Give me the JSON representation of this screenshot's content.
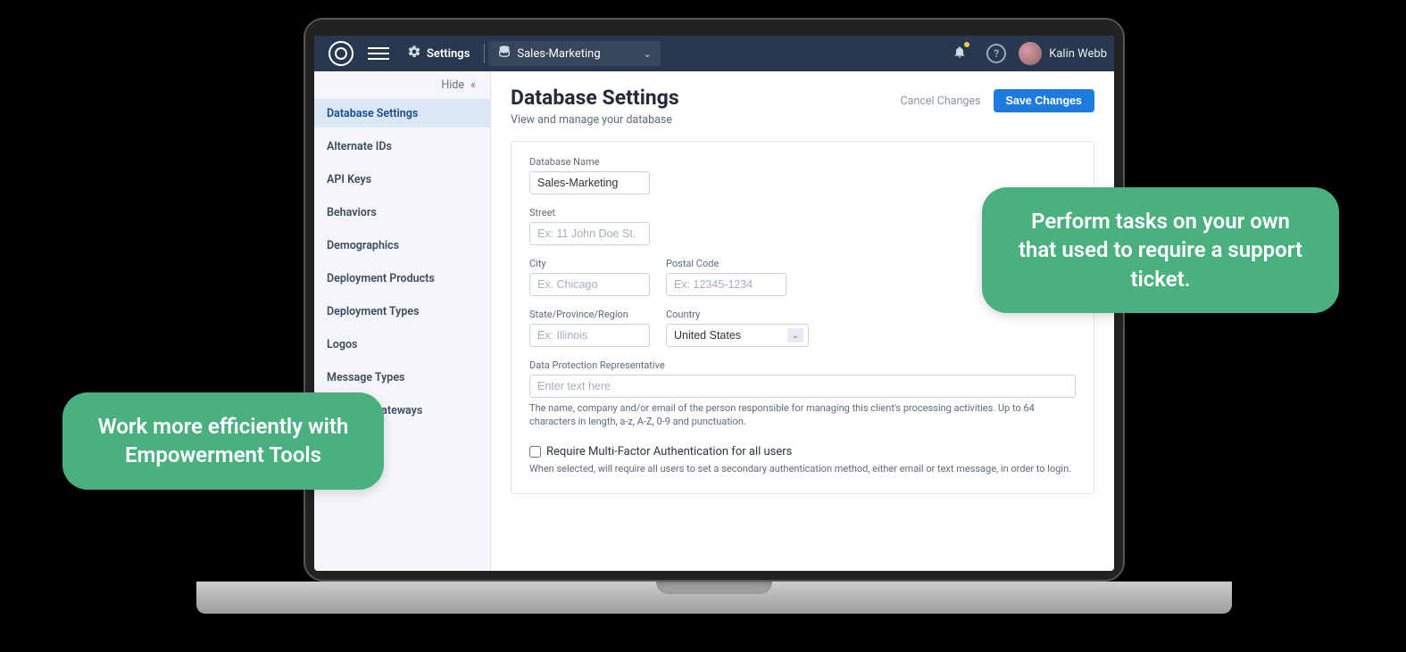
{
  "header": {
    "settings_label": "Settings",
    "database_name": "Sales-Marketing",
    "user_name": "Kalin Webb"
  },
  "sidebar": {
    "hide_label": "Hide",
    "items": [
      {
        "label": "Database Settings",
        "active": true
      },
      {
        "label": "Alternate IDs",
        "active": false
      },
      {
        "label": "API Keys",
        "active": false
      },
      {
        "label": "Behaviors",
        "active": false
      },
      {
        "label": "Demographics",
        "active": false
      },
      {
        "label": "Deployment Products",
        "active": false
      },
      {
        "label": "Deployment Types",
        "active": false
      },
      {
        "label": "Logos",
        "active": false
      },
      {
        "label": "Message Types",
        "active": false
      },
      {
        "label": "Payment Gateways",
        "active": false
      }
    ]
  },
  "page": {
    "title": "Database Settings",
    "subtitle": "View and manage your database",
    "cancel_label": "Cancel Changes",
    "save_label": "Save Changes"
  },
  "form": {
    "db_name_label": "Database Name",
    "db_name_value": "Sales-Marketing",
    "street_label": "Street",
    "street_placeholder": "Ex: 11 John Doe St.",
    "city_label": "City",
    "city_placeholder": "Ex. Chicago",
    "postal_label": "Postal Code",
    "postal_placeholder": "Ex: 12345-1234",
    "state_label": "State/Province/Region",
    "state_placeholder": "Ex: Illinois",
    "country_label": "Country",
    "country_value": "United States",
    "dpr_label": "Data Protection Representative",
    "dpr_placeholder": "Enter text here",
    "dpr_help": "The name, company and/or email of the person responsible for managing this client's processing activities. Up to 64 characters in length, a-z, A-Z, 0-9 and punctuation.",
    "mfa_label": "Require Multi-Factor Authentication for all users",
    "mfa_help": "When selected, will require all users to set a secondary authentication method, either email or text message, in order to login."
  },
  "callouts": {
    "left": "Work more efficiently with Empowerment Tools",
    "right": "Perform tasks on your own that used to require a support ticket."
  }
}
